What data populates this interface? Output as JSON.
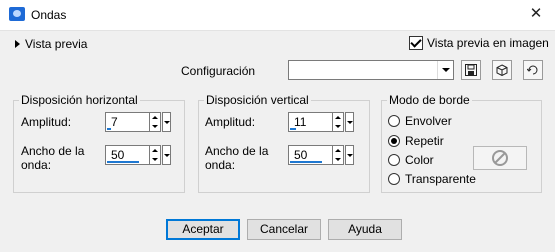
{
  "window": {
    "title": "Ondas"
  },
  "header": {
    "preview_label": "Vista previa",
    "live_preview_label": "Vista previa en imagen",
    "live_preview_checked": true
  },
  "config": {
    "label": "Configuración",
    "value": ""
  },
  "horizontal": {
    "title": "Disposición horizontal",
    "amplitude_label": "Amplitud:",
    "amplitude_value": "7",
    "wavelength_label_1": "Ancho de la",
    "wavelength_label_2": "onda:",
    "wavelength_value": "50"
  },
  "vertical": {
    "title": "Disposición vertical",
    "amplitude_label": "Amplitud:",
    "amplitude_value": "11",
    "wavelength_label_1": "Ancho de la",
    "wavelength_label_2": "onda:",
    "wavelength_value": "50"
  },
  "edge_mode": {
    "title": "Modo de borde",
    "options": [
      "Envolver",
      "Repetir",
      "Color",
      "Transparente"
    ],
    "selected": "Repetir"
  },
  "buttons": {
    "ok": "Aceptar",
    "cancel": "Cancelar",
    "help": "Ayuda"
  },
  "colors": {
    "accent": "#0078d7",
    "progress": "#1f78d1"
  }
}
